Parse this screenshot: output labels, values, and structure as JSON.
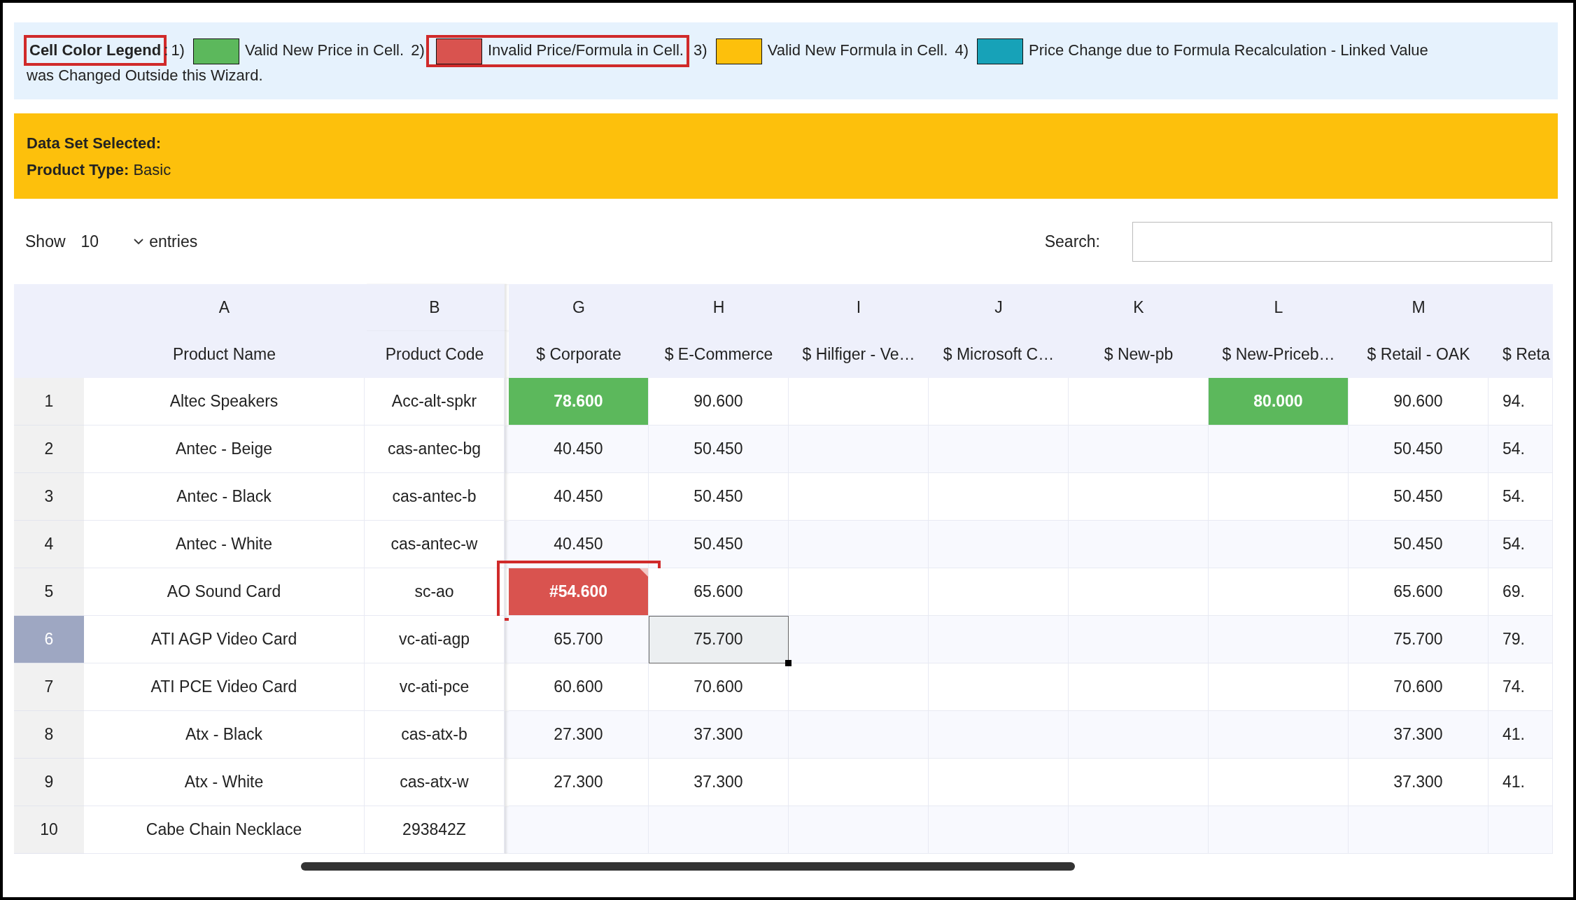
{
  "legend": {
    "title": "Cell Color Legend",
    "title_highlighted": true,
    "separator": ":",
    "items": [
      {
        "number": "1)",
        "color": "#5cb85c",
        "label": "Valid New Price in Cell.",
        "highlighted": false
      },
      {
        "number": "2)",
        "color": "#d9534f",
        "label": "Invalid Price/Formula in Cell.",
        "highlighted": true
      },
      {
        "number": "3)",
        "color": "#fdc00c",
        "label": "Valid New Formula in Cell.",
        "highlighted": false
      },
      {
        "number": "4)",
        "color": "#17a2b8",
        "label": "Price Change due to Formula Recalculation - Linked Value",
        "highlighted": false
      }
    ],
    "continuation": "was Changed Outside this Wizard."
  },
  "dataset": {
    "lines": [
      {
        "label": "Data Set Selected:"
      },
      {
        "label": "Product Type:",
        "value": "Basic"
      }
    ]
  },
  "length_control": {
    "before": "Show",
    "value": "10",
    "after": "entries"
  },
  "search": {
    "label": "Search:"
  },
  "table": {
    "columns": [
      {
        "letter": "A",
        "header": "Product Name"
      },
      {
        "letter": "B",
        "header": "Product Code"
      },
      {
        "letter": "G",
        "header": "$ Corporate"
      },
      {
        "letter": "H",
        "header": "$ E-Commerce"
      },
      {
        "letter": "I",
        "header": "$ Hilfiger - Ve…"
      },
      {
        "letter": "J",
        "header": "$ Microsoft C…"
      },
      {
        "letter": "K",
        "header": "$ New-pb"
      },
      {
        "letter": "L",
        "header": "$ New-Priceb…"
      },
      {
        "letter": "M",
        "header": "$ Retail - OAK"
      },
      {
        "header": "$ Reta"
      }
    ],
    "rows": [
      {
        "number": "1",
        "selected": false,
        "cells": [
          {
            "kind": "plain",
            "text": "Altec Speakers"
          },
          {
            "kind": "plain",
            "text": "Acc-alt-spkr"
          },
          {
            "kind": "valid",
            "text": "78.600"
          },
          {
            "kind": "plain",
            "text": "90.600"
          },
          {
            "kind": "plain"
          },
          {
            "kind": "plain"
          },
          {
            "kind": "plain"
          },
          {
            "kind": "valid",
            "text": "80.000"
          },
          {
            "kind": "plain",
            "text": "90.600"
          },
          {
            "kind": "plain",
            "text": "94."
          }
        ]
      },
      {
        "number": "2",
        "selected": false,
        "cells": [
          {
            "kind": "plain",
            "text": "Antec - Beige"
          },
          {
            "kind": "plain",
            "text": "cas-antec-bg"
          },
          {
            "kind": "plain",
            "text": "40.450"
          },
          {
            "kind": "plain",
            "text": "50.450"
          },
          {
            "kind": "plain"
          },
          {
            "kind": "plain"
          },
          {
            "kind": "plain"
          },
          {
            "kind": "plain"
          },
          {
            "kind": "plain",
            "text": "50.450"
          },
          {
            "kind": "plain",
            "text": "54."
          }
        ]
      },
      {
        "number": "3",
        "selected": false,
        "cells": [
          {
            "kind": "plain",
            "text": "Antec - Black"
          },
          {
            "kind": "plain",
            "text": "cas-antec-b"
          },
          {
            "kind": "plain",
            "text": "40.450"
          },
          {
            "kind": "plain",
            "text": "50.450"
          },
          {
            "kind": "plain"
          },
          {
            "kind": "plain"
          },
          {
            "kind": "plain"
          },
          {
            "kind": "plain"
          },
          {
            "kind": "plain",
            "text": "50.450"
          },
          {
            "kind": "plain",
            "text": "54."
          }
        ]
      },
      {
        "number": "4",
        "selected": false,
        "cells": [
          {
            "kind": "plain",
            "text": "Antec - White"
          },
          {
            "kind": "plain",
            "text": "cas-antec-w"
          },
          {
            "kind": "plain",
            "text": "40.450"
          },
          {
            "kind": "plain",
            "text": "50.450"
          },
          {
            "kind": "plain"
          },
          {
            "kind": "plain"
          },
          {
            "kind": "plain"
          },
          {
            "kind": "plain"
          },
          {
            "kind": "plain",
            "text": "50.450"
          },
          {
            "kind": "plain",
            "text": "54."
          }
        ]
      },
      {
        "number": "5",
        "selected": false,
        "cells": [
          {
            "kind": "plain",
            "text": "AO Sound Card"
          },
          {
            "kind": "plain",
            "text": "sc-ao"
          },
          {
            "kind": "invalid",
            "text": "#54.600",
            "highlighted": true,
            "comment": true
          },
          {
            "kind": "plain",
            "text": "65.600"
          },
          {
            "kind": "plain"
          },
          {
            "kind": "plain"
          },
          {
            "kind": "plain"
          },
          {
            "kind": "plain"
          },
          {
            "kind": "plain",
            "text": "65.600"
          },
          {
            "kind": "plain",
            "text": "69."
          }
        ]
      },
      {
        "number": "6",
        "selected": true,
        "cells": [
          {
            "kind": "plain",
            "text": "ATI AGP Video Card"
          },
          {
            "kind": "plain",
            "text": "vc-ati-agp"
          },
          {
            "kind": "plain",
            "text": "65.700"
          },
          {
            "kind": "active",
            "text": "75.700"
          },
          {
            "kind": "plain"
          },
          {
            "kind": "plain"
          },
          {
            "kind": "plain"
          },
          {
            "kind": "plain"
          },
          {
            "kind": "plain",
            "text": "75.700"
          },
          {
            "kind": "plain",
            "text": "79."
          }
        ]
      },
      {
        "number": "7",
        "selected": false,
        "cells": [
          {
            "kind": "plain",
            "text": "ATI PCE Video Card"
          },
          {
            "kind": "plain",
            "text": "vc-ati-pce"
          },
          {
            "kind": "plain",
            "text": "60.600"
          },
          {
            "kind": "plain",
            "text": "70.600"
          },
          {
            "kind": "plain"
          },
          {
            "kind": "plain"
          },
          {
            "kind": "plain"
          },
          {
            "kind": "plain"
          },
          {
            "kind": "plain",
            "text": "70.600"
          },
          {
            "kind": "plain",
            "text": "74."
          }
        ]
      },
      {
        "number": "8",
        "selected": false,
        "cells": [
          {
            "kind": "plain",
            "text": "Atx - Black"
          },
          {
            "kind": "plain",
            "text": "cas-atx-b"
          },
          {
            "kind": "plain",
            "text": "27.300"
          },
          {
            "kind": "plain",
            "text": "37.300"
          },
          {
            "kind": "plain"
          },
          {
            "kind": "plain"
          },
          {
            "kind": "plain"
          },
          {
            "kind": "plain"
          },
          {
            "kind": "plain",
            "text": "37.300"
          },
          {
            "kind": "plain",
            "text": "41."
          }
        ]
      },
      {
        "number": "9",
        "selected": false,
        "cells": [
          {
            "kind": "plain",
            "text": "Atx - White"
          },
          {
            "kind": "plain",
            "text": "cas-atx-w"
          },
          {
            "kind": "plain",
            "text": "27.300"
          },
          {
            "kind": "plain",
            "text": "37.300"
          },
          {
            "kind": "plain"
          },
          {
            "kind": "plain"
          },
          {
            "kind": "plain"
          },
          {
            "kind": "plain"
          },
          {
            "kind": "plain",
            "text": "37.300"
          },
          {
            "kind": "plain",
            "text": "41."
          }
        ]
      },
      {
        "number": "10",
        "selected": false,
        "cells": [
          {
            "kind": "plain",
            "text": "Cabe Chain Necklace"
          },
          {
            "kind": "plain",
            "text": "293842Z"
          },
          {
            "kind": "plain"
          },
          {
            "kind": "plain"
          },
          {
            "kind": "plain"
          },
          {
            "kind": "plain"
          },
          {
            "kind": "plain"
          },
          {
            "kind": "plain"
          },
          {
            "kind": "plain"
          },
          {
            "kind": "plain"
          }
        ]
      }
    ]
  }
}
